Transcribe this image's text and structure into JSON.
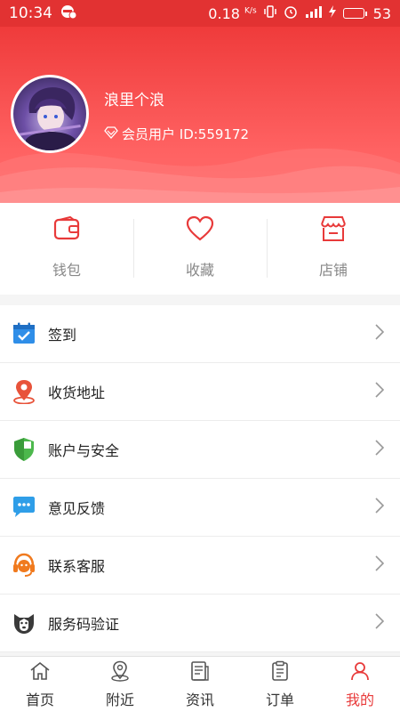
{
  "status_bar": {
    "time": "10:34",
    "speed": "0.18",
    "speed_unit": "K/s",
    "battery": "53",
    "battery_level": 0.53
  },
  "profile": {
    "username": "浪里个浪",
    "member_text": "会员用户 ID:559172"
  },
  "quick_actions": [
    {
      "label": "钱包",
      "icon": "wallet-icon"
    },
    {
      "label": "收藏",
      "icon": "heart-icon"
    },
    {
      "label": "店铺",
      "icon": "store-icon"
    }
  ],
  "menu": [
    {
      "label": "签到",
      "icon": "calendar-check-icon"
    },
    {
      "label": "收货地址",
      "icon": "location-pin-icon"
    },
    {
      "label": "账户与安全",
      "icon": "shield-icon"
    },
    {
      "label": "意见反馈",
      "icon": "chat-bubble-icon"
    },
    {
      "label": "联系客服",
      "icon": "headset-icon"
    },
    {
      "label": "服务码验证",
      "icon": "dog-icon"
    }
  ],
  "tabs": [
    {
      "label": "首页",
      "icon": "home-icon",
      "active": false
    },
    {
      "label": "附近",
      "icon": "location-icon",
      "active": false
    },
    {
      "label": "资讯",
      "icon": "news-icon",
      "active": false
    },
    {
      "label": "订单",
      "icon": "order-icon",
      "active": false
    },
    {
      "label": "我的",
      "icon": "user-icon",
      "active": true
    }
  ],
  "colors": {
    "brand_red": "#e83a3a",
    "header_red": "#ef3b3b"
  }
}
